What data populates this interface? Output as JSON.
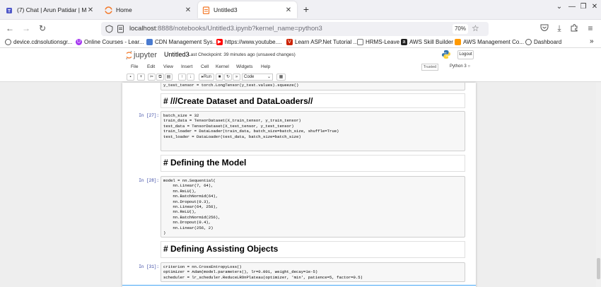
{
  "browser": {
    "tabs": [
      {
        "title": "(7) Chat | Arun Patidar | Micros",
        "icon": "teams-icon",
        "active": false
      },
      {
        "title": "Home",
        "icon": "jupyter-tab-icon",
        "active": false
      },
      {
        "title": "Untitled3",
        "icon": "notebook-tab-icon",
        "active": true
      }
    ],
    "close_glyph": "✕",
    "new_tab_glyph": "+",
    "url_host": "localhost",
    "url_path": ":8888/notebooks/Untitled3.ipynb?kernel_name=python3",
    "zoom": "70%",
    "bookmarks": [
      {
        "label": "device.cdnsolutionsgr...",
        "icon": "globe-icon",
        "color": "#555555"
      },
      {
        "label": "Online Courses - Lear...",
        "icon": "udemy-icon",
        "color": "#a435f0"
      },
      {
        "label": "CDN Management Sys...",
        "icon": "page-icon",
        "color": "#4a7bd0"
      },
      {
        "label": "https://www.youtube....",
        "icon": "youtube-icon",
        "color": "#ff0000"
      },
      {
        "label": "Learn ASP.Net Tutorial ...",
        "icon": "tutorial-icon",
        "color": "#cc2200"
      },
      {
        "label": "HRMS-Leave",
        "icon": "document-icon",
        "color": "#777777"
      },
      {
        "label": "AWS Skill Builder",
        "icon": "aws-icon",
        "color": "#222222"
      },
      {
        "label": "AWS Management Co...",
        "icon": "aws-cube-icon",
        "color": "#ff9900"
      },
      {
        "label": "Dashboard",
        "icon": "globe-icon",
        "color": "#555555"
      }
    ],
    "bookmarks_more": "»"
  },
  "jupyter": {
    "logo_text": "jupyter",
    "notebook_name": "Untitled3",
    "checkpoint": "Last Checkpoint: 39 minutes ago",
    "unsaved": "(unsaved changes)",
    "logout_label": "Logout",
    "menu": [
      "File",
      "Edit",
      "View",
      "Insert",
      "Cell",
      "Kernel",
      "Widgets",
      "Help"
    ],
    "trusted": "Trusted",
    "kernel": "Python 3",
    "run_label": "Run",
    "cell_type": "Code"
  },
  "cells": [
    {
      "kind": "code",
      "prompt": "",
      "lines": [
        "y_test_tensor = torch.LongTensor(y_test.values).squeeze()"
      ]
    },
    {
      "kind": "markdown",
      "text": "# ///Create Dataset and DataLoaders//"
    },
    {
      "kind": "code",
      "prompt": "In [27]:",
      "lines": [
        "batch_size = 32",
        "",
        "train_data = TensorDataset(X_train_tensor, y_train_tensor)",
        "test_data = TensorDataset(X_test_tensor, y_test_tensor)",
        "",
        "train_loader = DataLoader(train_data, batch_size=batch_size, shuffle=True)",
        "test_loader = DataLoader(test_data, batch_size=batch_size)"
      ]
    },
    {
      "kind": "markdown",
      "text": "# Defining the Model"
    },
    {
      "kind": "code",
      "prompt": "In [28]:",
      "lines": [
        "model = nn.Sequential(",
        "    nn.Linear(7, 64),",
        "    nn.ReLU(),",
        "    nn.BatchNorm1d(64),",
        "    nn.Dropout(0.3),",
        "    nn.Linear(64, 256),",
        "    nn.ReLU(),",
        "    nn.BatchNorm1d(256),",
        "    nn.Dropout(0.4),",
        "    nn.Linear(256, 2)",
        ")"
      ]
    },
    {
      "kind": "markdown",
      "text": "# Defining Assisting Objects"
    },
    {
      "kind": "code",
      "prompt": "In [31]:",
      "lines": [
        "criterion = nn.CrossEntropyLoss()",
        "optimizer = Adam(model.parameters(), lr=0.001, weight_decay=1e-5)",
        "scheduler = lr_scheduler.ReduceLROnPlateau(optimizer, 'min', patience=5, factor=0.5)"
      ]
    }
  ]
}
